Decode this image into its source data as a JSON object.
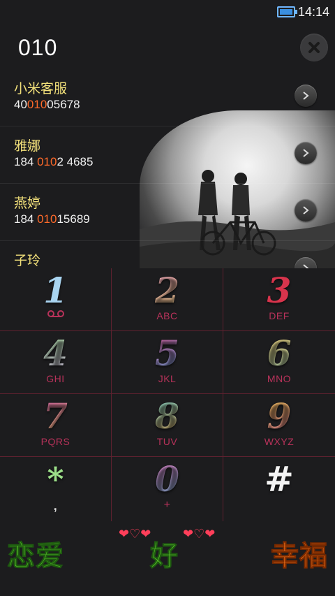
{
  "status": {
    "time": "14:14"
  },
  "dial": {
    "number": "010"
  },
  "contacts": [
    {
      "name": "小米客服",
      "num_pre": "40",
      "num_hl": "010",
      "num_post": "05678"
    },
    {
      "name": "雅娜",
      "num_pre": "184 ",
      "num_hl": "010",
      "num_post": "2 4685"
    },
    {
      "name": "燕婷",
      "num_pre": "184 ",
      "num_hl": "010",
      "num_post": "15689"
    },
    {
      "name": "子玲",
      "num_pre": "",
      "num_hl": "",
      "num_post": ""
    }
  ],
  "keypad": [
    {
      "digit": "1",
      "letters": ""
    },
    {
      "digit": "2",
      "letters": "ABC"
    },
    {
      "digit": "3",
      "letters": "DEF"
    },
    {
      "digit": "4",
      "letters": "GHI"
    },
    {
      "digit": "5",
      "letters": "JKL"
    },
    {
      "digit": "6",
      "letters": "MNO"
    },
    {
      "digit": "7",
      "letters": "PQRS"
    },
    {
      "digit": "8",
      "letters": "TUV"
    },
    {
      "digit": "9",
      "letters": "WXYZ"
    },
    {
      "digit": "*",
      "letters": ","
    },
    {
      "digit": "0",
      "letters": "+"
    },
    {
      "digit": "#",
      "letters": ""
    }
  ],
  "bottom": {
    "left_label": "恋爱",
    "middle_label": "好",
    "right_label": "幸福"
  },
  "colors": {
    "highlight": "#ff6a2a",
    "contact_name": "#f2e07a",
    "keypad_grid": "#b4284a",
    "letters": "#b8325a"
  }
}
